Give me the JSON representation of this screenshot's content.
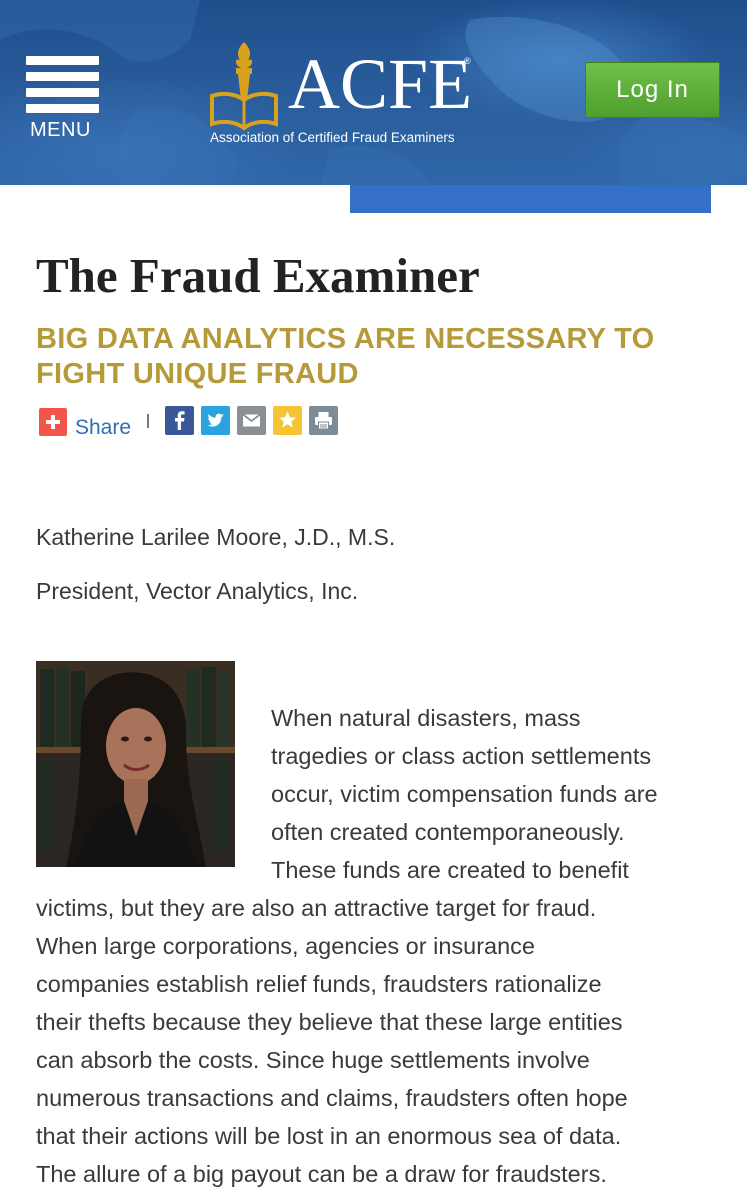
{
  "header": {
    "menu_label": "MENU",
    "logo_text": "ACFE",
    "logo_reg": "®",
    "logo_tagline": "Association of Certified Fraud Examiners",
    "login_label": "Log In"
  },
  "article": {
    "publication": "The Fraud Examiner",
    "headline": "BIG DATA ANALYTICS ARE NECESSARY TO FIGHT UNIQUE FRAUD",
    "share_label": "Share",
    "share_icons": [
      "plus-icon",
      "facebook-icon",
      "twitter-icon",
      "email-icon",
      "favorite-star-icon",
      "print-icon"
    ],
    "author_name": "Katherine Larilee Moore, J.D., M.S.",
    "author_title": "President, Vector Analytics, Inc.",
    "body_lines": [
      "When natural disasters, mass",
      "tragedies or class action settlements",
      "occur, victim compensation funds are",
      "often created contemporaneously.",
      "These funds are created to benefit",
      "victims, but they are also an attractive target for fraud.",
      "When large corporations, agencies or insurance",
      "companies establish relief funds, fraudsters rationalize",
      "their thefts because they believe that these large entities",
      "can absorb the costs. Since huge settlements involve",
      "numerous transactions and claims, fraudsters often hope",
      "that their actions will be lost in an enormous sea of data.",
      "The allure of a big payout can be a draw for fraudsters."
    ]
  },
  "colors": {
    "header_blue": "#2a5d9c",
    "login_green": "#5aab38",
    "accent_blue": "#3470c8",
    "headline_gold": "#b59a3a",
    "share_red": "#f2564a"
  }
}
